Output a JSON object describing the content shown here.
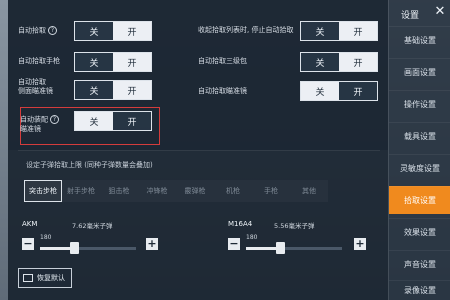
{
  "sidebar": {
    "title": "设置",
    "items": [
      {
        "label": "基础设置"
      },
      {
        "label": "画面设置"
      },
      {
        "label": "操作设置"
      },
      {
        "label": "载具设置"
      },
      {
        "label": "灵敏度设置"
      },
      {
        "label": "拾取设置"
      },
      {
        "label": "效果设置"
      },
      {
        "label": "声音设置"
      },
      {
        "label": "录像设置"
      }
    ],
    "active_item": "拾取设置"
  },
  "settings": {
    "auto_pickup": {
      "label": "自动拾取",
      "off": "关",
      "on": "开",
      "selected": "on"
    },
    "auto_pickup_hand_cannon": {
      "label": "自动拾取手枪",
      "off": "关",
      "on": "开",
      "selected": "on"
    },
    "auto_pickup_reticle": {
      "label_line1": "自动拾取",
      "label_line2": "倍瞄准镜",
      "label_line3": "侧面瞄准镜",
      "off": "关",
      "on": "开",
      "selected": "on"
    },
    "auto_equip_scope": {
      "label_line1": "自动装配",
      "label_line2": "瞄准镜",
      "off": "关",
      "on": "开",
      "selected": "off"
    },
    "stop_auto_pickup_on_list_collapse": {
      "label": "收起拾取列表时, 停止自动拾取",
      "off": "关",
      "on": "开",
      "selected": "on"
    },
    "auto_pickup_level3_bag": {
      "label": "自动拾取三级包",
      "off": "关",
      "on": "开",
      "selected": "on"
    },
    "auto_pickup_scope": {
      "label": "自动拾取瞄准镜",
      "off": "关",
      "on": "开",
      "selected": "off"
    }
  },
  "ammo_section": {
    "title": "设定子弹拾取上限 (同种子弹数量会叠加)",
    "tabs": [
      "突击步枪",
      "射手步枪",
      "狙击枪",
      "冲锋枪",
      "霰弹枪",
      "机枪",
      "手枪",
      "其他"
    ],
    "active_tab": "突击步枪",
    "guns": [
      {
        "name": "AKM",
        "ammo": "7.62毫米子弹",
        "value": "180",
        "fraction": 0.35
      },
      {
        "name": "M16A4",
        "ammo": "5.56毫米子弹",
        "value": "180",
        "fraction": 0.35
      }
    ]
  },
  "footer": {
    "reset_label": "恢复默认"
  }
}
